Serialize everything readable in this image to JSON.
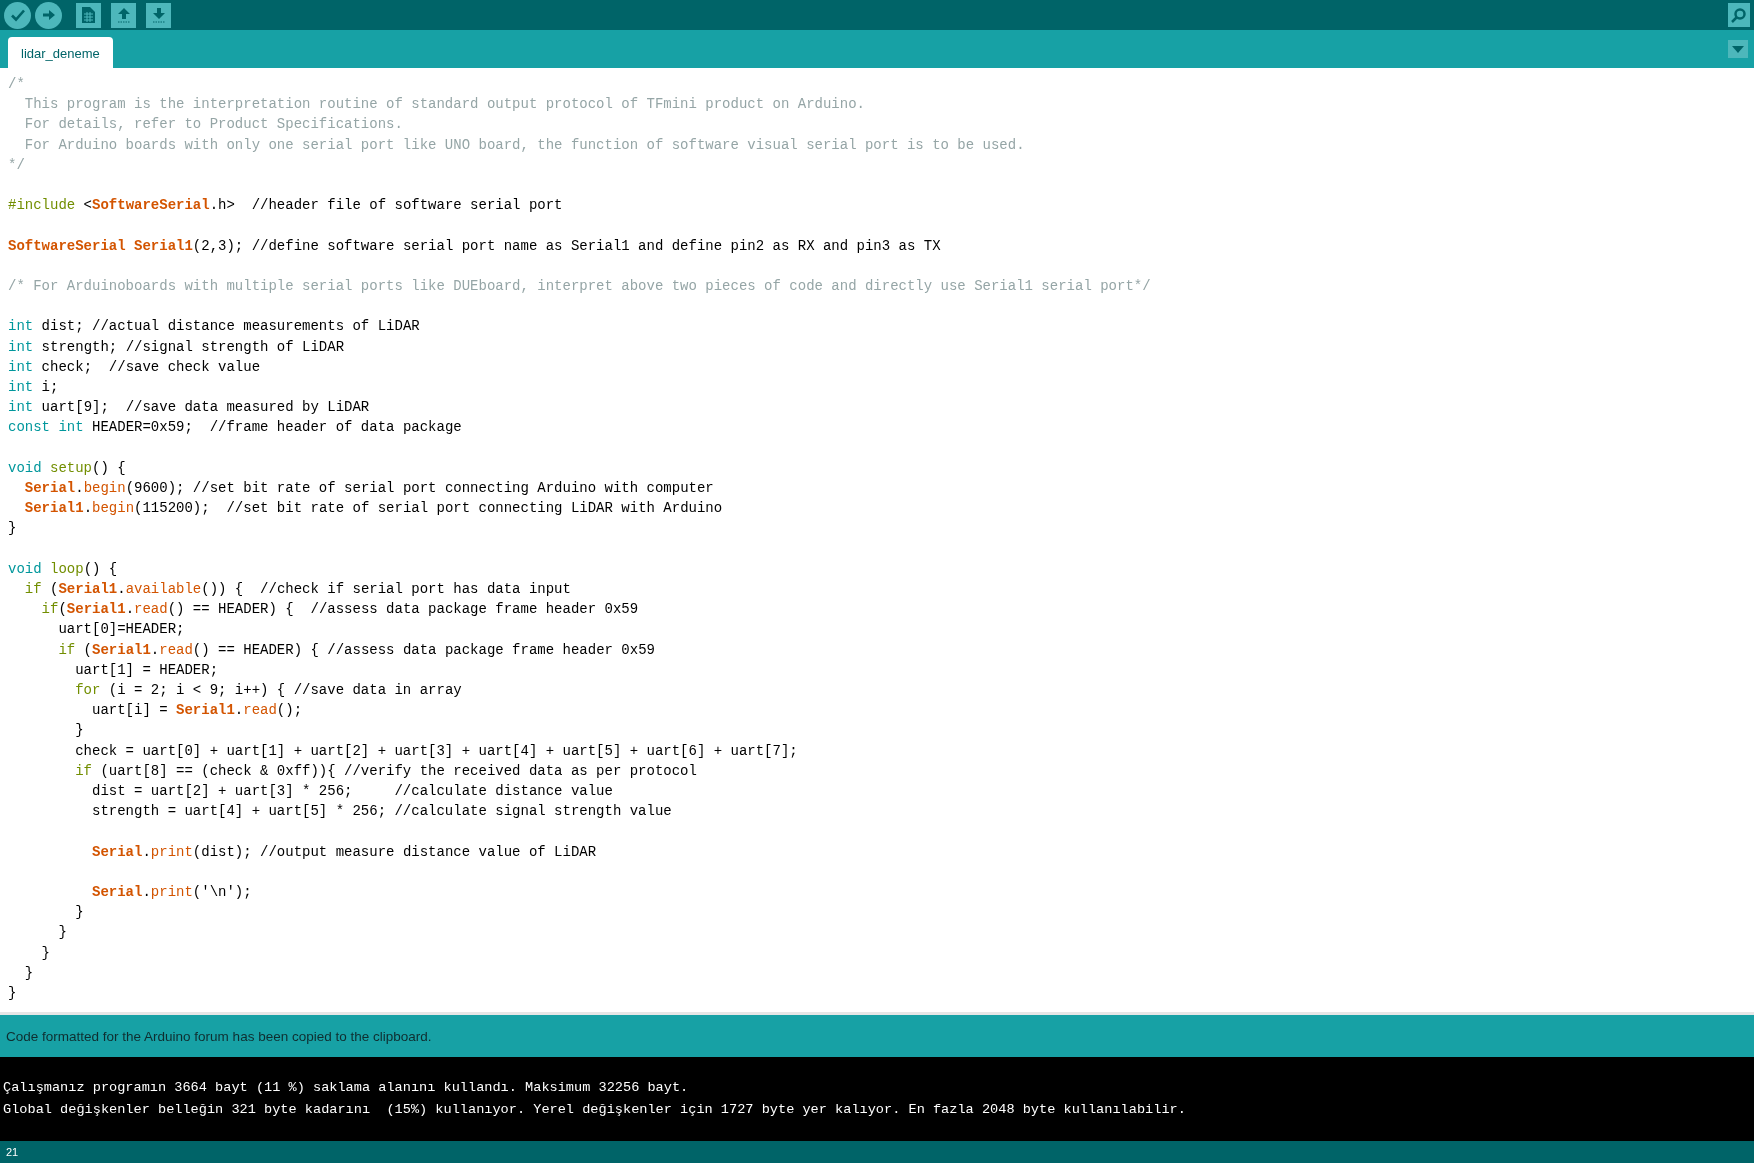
{
  "tabs": [
    {
      "label": "lidar_deneme",
      "selected": true
    }
  ],
  "code_lines": [
    {
      "blank_line_before": false,
      "tokens": [
        {
          "kind": "comment",
          "text": "/*"
        }
      ]
    },
    {
      "blank_line_before": false,
      "tokens": [
        {
          "kind": "comment",
          "text": "  This program is the interpretation routine of standard output protocol of TFmini product on Arduino."
        }
      ]
    },
    {
      "blank_line_before": false,
      "tokens": [
        {
          "kind": "comment",
          "text": "  For details, refer to Product Specifications."
        }
      ]
    },
    {
      "blank_line_before": false,
      "tokens": [
        {
          "kind": "comment",
          "text": "  For Arduino boards with only one serial port like UNO board, the function of software visual serial port is to be used."
        }
      ]
    },
    {
      "blank_line_before": false,
      "tokens": [
        {
          "kind": "comment",
          "text": "*/"
        }
      ]
    },
    {
      "blank_line_before": true,
      "tokens": [
        {
          "kind": "keyword",
          "text": "#include"
        },
        {
          "kind": "plain",
          "text": " <"
        },
        {
          "kind": "class",
          "text": "SoftwareSerial"
        },
        {
          "kind": "plain",
          "text": ".h>  //header file of software serial port"
        }
      ]
    },
    {
      "blank_line_before": true,
      "tokens": [
        {
          "kind": "class",
          "text": "SoftwareSerial "
        },
        {
          "kind": "class",
          "text": "Serial1"
        },
        {
          "kind": "plain",
          "text": "(2,3); //define software serial port name as Serial1 and define pin2 as RX and pin3 as TX"
        }
      ]
    },
    {
      "blank_line_before": true,
      "tokens": [
        {
          "kind": "comment",
          "text": "/* For Arduinoboards with multiple serial ports like DUEboard, interpret above two pieces of code and directly use Serial1 serial port*/"
        }
      ]
    },
    {
      "blank_line_before": true,
      "tokens": [
        {
          "kind": "type",
          "text": "int"
        },
        {
          "kind": "plain",
          "text": " dist; //actual distance measurements of LiDAR"
        }
      ]
    },
    {
      "blank_line_before": false,
      "tokens": [
        {
          "kind": "type",
          "text": "int"
        },
        {
          "kind": "plain",
          "text": " strength; //signal strength of LiDAR"
        }
      ]
    },
    {
      "blank_line_before": false,
      "tokens": [
        {
          "kind": "type",
          "text": "int"
        },
        {
          "kind": "plain",
          "text": " check;  //save check value"
        }
      ]
    },
    {
      "blank_line_before": false,
      "tokens": [
        {
          "kind": "type",
          "text": "int"
        },
        {
          "kind": "plain",
          "text": " i;"
        }
      ]
    },
    {
      "blank_line_before": false,
      "tokens": [
        {
          "kind": "type",
          "text": "int"
        },
        {
          "kind": "plain",
          "text": " uart[9];  //save data measured by LiDAR"
        }
      ]
    },
    {
      "blank_line_before": false,
      "tokens": [
        {
          "kind": "type",
          "text": "const int"
        },
        {
          "kind": "plain",
          "text": " HEADER=0x59;  //frame header of data package"
        }
      ]
    },
    {
      "blank_line_before": true,
      "tokens": [
        {
          "kind": "type",
          "text": "void "
        },
        {
          "kind": "keyword",
          "text": "setup"
        },
        {
          "kind": "plain",
          "text": "() {"
        }
      ]
    },
    {
      "blank_line_before": false,
      "tokens": [
        {
          "kind": "class",
          "text": "  Serial"
        },
        {
          "kind": "plain",
          "text": "."
        },
        {
          "kind": "method",
          "text": "begin"
        },
        {
          "kind": "plain",
          "text": "(9600); //set bit rate of serial port connecting Arduino with computer"
        }
      ]
    },
    {
      "blank_line_before": false,
      "tokens": [
        {
          "kind": "class",
          "text": "  Serial1"
        },
        {
          "kind": "plain",
          "text": "."
        },
        {
          "kind": "method",
          "text": "begin"
        },
        {
          "kind": "plain",
          "text": "(115200);  //set bit rate of serial port connecting LiDAR with Arduino"
        }
      ]
    },
    {
      "blank_line_before": false,
      "tokens": [
        {
          "kind": "plain",
          "text": "}"
        }
      ]
    },
    {
      "blank_line_before": true,
      "tokens": [
        {
          "kind": "type",
          "text": "void "
        },
        {
          "kind": "keyword",
          "text": "loop"
        },
        {
          "kind": "plain",
          "text": "() {"
        }
      ]
    },
    {
      "blank_line_before": false,
      "tokens": [
        {
          "kind": "keyword",
          "text": "  if"
        },
        {
          "kind": "plain",
          "text": " ("
        },
        {
          "kind": "class",
          "text": "Serial1"
        },
        {
          "kind": "plain",
          "text": "."
        },
        {
          "kind": "method",
          "text": "available"
        },
        {
          "kind": "plain",
          "text": "()) {  //check if serial port has data input"
        }
      ]
    },
    {
      "blank_line_before": false,
      "tokens": [
        {
          "kind": "keyword",
          "text": "    if"
        },
        {
          "kind": "plain",
          "text": "("
        },
        {
          "kind": "class",
          "text": "Serial1"
        },
        {
          "kind": "plain",
          "text": "."
        },
        {
          "kind": "method",
          "text": "read"
        },
        {
          "kind": "plain",
          "text": "() == HEADER) {  //assess data package frame header 0x59"
        }
      ]
    },
    {
      "blank_line_before": false,
      "tokens": [
        {
          "kind": "plain",
          "text": "      uart[0]=HEADER;"
        }
      ]
    },
    {
      "blank_line_before": false,
      "tokens": [
        {
          "kind": "keyword",
          "text": "      if"
        },
        {
          "kind": "plain",
          "text": " ("
        },
        {
          "kind": "class",
          "text": "Serial1"
        },
        {
          "kind": "plain",
          "text": "."
        },
        {
          "kind": "method",
          "text": "read"
        },
        {
          "kind": "plain",
          "text": "() == HEADER) { //assess data package frame header 0x59"
        }
      ]
    },
    {
      "blank_line_before": false,
      "tokens": [
        {
          "kind": "plain",
          "text": "        uart[1] = HEADER;"
        }
      ]
    },
    {
      "blank_line_before": false,
      "tokens": [
        {
          "kind": "keyword",
          "text": "        for"
        },
        {
          "kind": "plain",
          "text": " (i = 2; i < 9; i++) { //save data in array"
        }
      ]
    },
    {
      "blank_line_before": false,
      "tokens": [
        {
          "kind": "plain",
          "text": "          uart[i] = "
        },
        {
          "kind": "class",
          "text": "Serial1"
        },
        {
          "kind": "plain",
          "text": "."
        },
        {
          "kind": "method",
          "text": "read"
        },
        {
          "kind": "plain",
          "text": "();"
        }
      ]
    },
    {
      "blank_line_before": false,
      "tokens": [
        {
          "kind": "plain",
          "text": "        }"
        }
      ]
    },
    {
      "blank_line_before": false,
      "tokens": [
        {
          "kind": "plain",
          "text": "        check = uart[0] + uart[1] + uart[2] + uart[3] + uart[4] + uart[5] + uart[6] + uart[7];"
        }
      ]
    },
    {
      "blank_line_before": false,
      "tokens": [
        {
          "kind": "keyword",
          "text": "        if"
        },
        {
          "kind": "plain",
          "text": " (uart[8] == (check & 0xff)){ //verify the received data as per protocol"
        }
      ]
    },
    {
      "blank_line_before": false,
      "tokens": [
        {
          "kind": "plain",
          "text": "          dist = uart[2] + uart[3] * 256;     //calculate distance value"
        }
      ]
    },
    {
      "blank_line_before": false,
      "tokens": [
        {
          "kind": "plain",
          "text": "          strength = uart[4] + uart[5] * 256; //calculate signal strength value"
        }
      ]
    },
    {
      "blank_line_before": true,
      "tokens": [
        {
          "kind": "class",
          "text": "          Serial"
        },
        {
          "kind": "plain",
          "text": "."
        },
        {
          "kind": "method",
          "text": "print"
        },
        {
          "kind": "plain",
          "text": "(dist); //output measure distance value of LiDAR"
        }
      ]
    },
    {
      "blank_line_before": true,
      "tokens": [
        {
          "kind": "class",
          "text": "          Serial"
        },
        {
          "kind": "plain",
          "text": "."
        },
        {
          "kind": "method",
          "text": "print"
        },
        {
          "kind": "plain",
          "text": "('\\n');"
        }
      ]
    },
    {
      "blank_line_before": false,
      "tokens": [
        {
          "kind": "plain",
          "text": "        }"
        }
      ]
    },
    {
      "blank_line_before": false,
      "tokens": [
        {
          "kind": "plain",
          "text": "      }"
        }
      ]
    },
    {
      "blank_line_before": false,
      "tokens": [
        {
          "kind": "plain",
          "text": "    }"
        }
      ]
    },
    {
      "blank_line_before": false,
      "tokens": [
        {
          "kind": "plain",
          "text": "  }"
        }
      ]
    },
    {
      "blank_line_before": false,
      "tokens": [
        {
          "kind": "plain",
          "text": "}"
        }
      ]
    }
  ],
  "status_message": "Code formatted for the Arduino forum has been copied to the clipboard.",
  "console_lines": [
    "Çalışmanız programın 3664 bayt (11 %) saklama alanını kullandı. Maksimum 32256 bayt.",
    "Global değişkenler belleğin 321 byte kadarını  (15%) kullanıyor. Yerel değişkenler için 1727 byte yer kalıyor. En fazla 2048 byte kullanılabilir."
  ],
  "line_number": "21"
}
